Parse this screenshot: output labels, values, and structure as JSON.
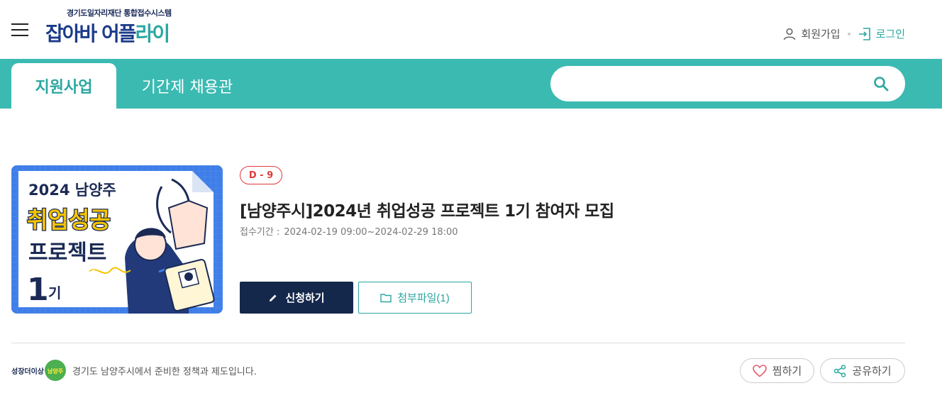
{
  "header": {
    "logo_subtitle": "경기도일자리재단 통합접수시스템",
    "logo_part1": "잡아바",
    "logo_part2": " 어플",
    "logo_part3": "라이",
    "signup_label": "회원가입",
    "login_label": "로그인"
  },
  "nav": {
    "tabs": [
      {
        "label": "지원사업",
        "active": true
      },
      {
        "label": "기간제 채용관",
        "active": false
      }
    ],
    "search": {
      "placeholder": "",
      "value": ""
    }
  },
  "detail": {
    "dday": "D - 9",
    "title": "[남양주시]2024년 취업성공 프로젝트 1기 참여자 모집",
    "period_label": "접수기간 :",
    "period_value": "2024-02-19 09:00~2024-02-29 18:00",
    "apply_button": "신청하기",
    "file_button": "첨부파일(1)",
    "thumbnail": {
      "line1": "2024 남양주",
      "line2": "취업성공",
      "line3": "프로젝트",
      "line4_num": "1",
      "line4_suffix": "기"
    }
  },
  "footer": {
    "org_logo_text": "성장더이상",
    "org_logo_badge": "남양주",
    "org_description": "경기도 남양주시에서 준비한 정책과 제도입니다.",
    "like_label": "찜하기",
    "share_label": "공유하기"
  },
  "colors": {
    "accent": "#3bbab2",
    "accent_text": "#2aa7a0",
    "navy": "#14284b",
    "dday_red": "#e03a3a"
  }
}
